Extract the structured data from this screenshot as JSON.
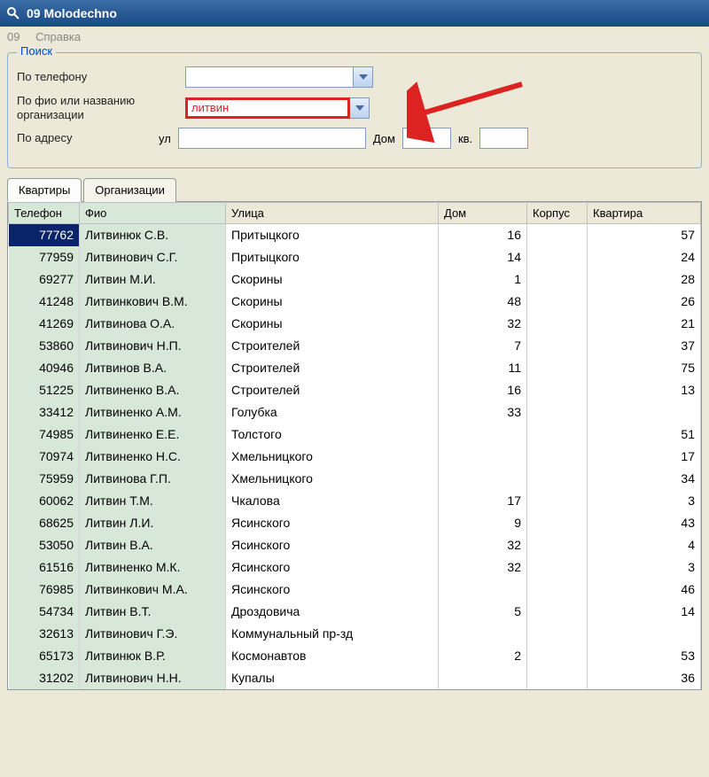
{
  "window": {
    "title": "09 Molodechno"
  },
  "menu": {
    "item1": "09",
    "item2": "Справка"
  },
  "search": {
    "legend": "Поиск",
    "by_phone_label": "По телефону",
    "by_phone_value": "",
    "by_fio_label": "По фио или названию организации",
    "by_fio_value": "литвин",
    "by_addr_label": "По адресу",
    "street_prefix": "ул",
    "street_value": "",
    "house_label": "Дом",
    "house_value": "",
    "apt_label": "кв.",
    "apt_value": ""
  },
  "tabs": {
    "t1": "Квартиры",
    "t2": "Организации"
  },
  "columns": {
    "phone": "Телефон",
    "fio": "Фио",
    "street": "Улица",
    "dom": "Дом",
    "korp": "Корпус",
    "kv": "Квартира"
  },
  "rows": [
    {
      "phone": "77762",
      "fio": "Литвинюк С.В.",
      "street": "Притыцкого",
      "dom": "16",
      "korp": "",
      "kv": "57",
      "selected": true
    },
    {
      "phone": "77959",
      "fio": "Литвинович С.Г.",
      "street": "Притыцкого",
      "dom": "14",
      "korp": "",
      "kv": "24"
    },
    {
      "phone": "69277",
      "fio": "Литвин М.И.",
      "street": "Скорины",
      "dom": "1",
      "korp": "",
      "kv": "28"
    },
    {
      "phone": "41248",
      "fio": "Литвинкович В.М.",
      "street": "Скорины",
      "dom": "48",
      "korp": "",
      "kv": "26"
    },
    {
      "phone": "41269",
      "fio": "Литвинова О.А.",
      "street": "Скорины",
      "dom": "32",
      "korp": "",
      "kv": "21"
    },
    {
      "phone": "53860",
      "fio": "Литвинович Н.П.",
      "street": "Строителей",
      "dom": "7",
      "korp": "",
      "kv": "37"
    },
    {
      "phone": "40946",
      "fio": "Литвинов В.А.",
      "street": "Строителей",
      "dom": "11",
      "korp": "",
      "kv": "75"
    },
    {
      "phone": "51225",
      "fio": "Литвиненко В.А.",
      "street": "Строителей",
      "dom": "16",
      "korp": "",
      "kv": "13"
    },
    {
      "phone": "33412",
      "fio": "Литвиненко А.М.",
      "street": "Голубка",
      "dom": "33",
      "korp": "",
      "kv": ""
    },
    {
      "phone": "74985",
      "fio": "Литвиненко Е.Е.",
      "street": "Толстого",
      "dom": "",
      "korp": "",
      "kv": "51"
    },
    {
      "phone": "70974",
      "fio": "Литвиненко Н.С.",
      "street": "Хмельницкого",
      "dom": "",
      "korp": "",
      "kv": "17"
    },
    {
      "phone": "75959",
      "fio": "Литвинова Г.П.",
      "street": "Хмельницкого",
      "dom": "",
      "korp": "",
      "kv": "34"
    },
    {
      "phone": "60062",
      "fio": "Литвин Т.М.",
      "street": "Чкалова",
      "dom": "17",
      "korp": "",
      "kv": "3"
    },
    {
      "phone": "68625",
      "fio": "Литвин Л.И.",
      "street": "Ясинского",
      "dom": "9",
      "korp": "",
      "kv": "43"
    },
    {
      "phone": "53050",
      "fio": "Литвин В.А.",
      "street": "Ясинского",
      "dom": "32",
      "korp": "",
      "kv": "4"
    },
    {
      "phone": "61516",
      "fio": "Литвиненко М.К.",
      "street": "Ясинского",
      "dom": "32",
      "korp": "",
      "kv": "3"
    },
    {
      "phone": "76985",
      "fio": "Литвинкович М.А.",
      "street": "Ясинского",
      "dom": "",
      "korp": "",
      "kv": "46"
    },
    {
      "phone": "54734",
      "fio": "Литвин В.Т.",
      "street": "Дроздовича",
      "dom": "5",
      "korp": "",
      "kv": "14"
    },
    {
      "phone": "32613",
      "fio": "Литвинович Г.Э.",
      "street": "Коммунальный пр-зд",
      "dom": "",
      "korp": "",
      "kv": ""
    },
    {
      "phone": "65173",
      "fio": "Литвинюк В.Р.",
      "street": "Космонавтов",
      "dom": "2",
      "korp": "",
      "kv": "53"
    },
    {
      "phone": "31202",
      "fio": "Литвинович Н.Н.",
      "street": "Купалы",
      "dom": "",
      "korp": "",
      "kv": "36"
    }
  ]
}
